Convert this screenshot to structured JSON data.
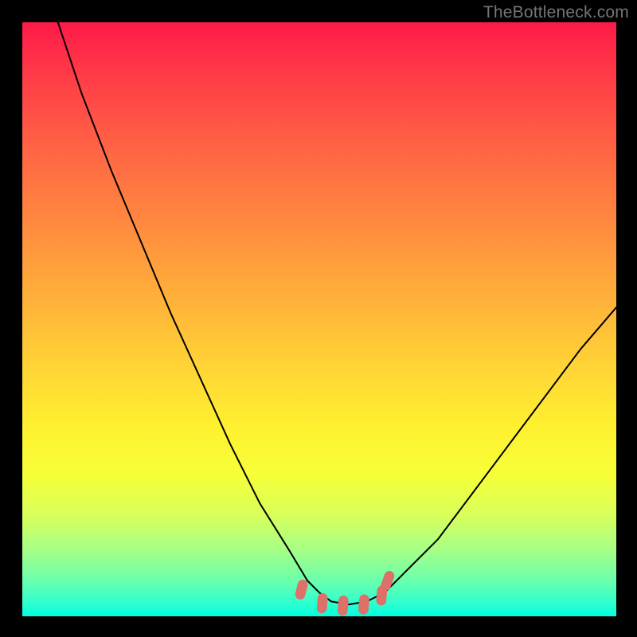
{
  "watermark": "TheBottleneck.com",
  "colors": {
    "frame_bg": "#000000",
    "curve": "#000000",
    "marker": "#dd7068",
    "watermark_text": "#757575",
    "gradient_top": "#ff1a49",
    "gradient_bottom": "#00ffe0"
  },
  "chart_data": {
    "type": "line",
    "title": "",
    "xlabel": "",
    "ylabel": "",
    "xlim": [
      0,
      100
    ],
    "ylim": [
      0,
      100
    ],
    "note": "Axes are unlabeled in the image; x and y are in percent of plot width/height. y=0 at bottom (green), y=100 at top (red). Curve is a V-shape with minimum near x≈55; right branch exits around y≈50 at right edge.",
    "series": [
      {
        "name": "bottleneck-curve",
        "x": [
          6,
          10,
          15,
          20,
          25,
          30,
          35,
          40,
          45,
          48,
          50,
          52,
          55,
          58,
          61,
          64,
          70,
          76,
          82,
          88,
          94,
          100
        ],
        "y": [
          100,
          88,
          75,
          63,
          51,
          40,
          29,
          19,
          11,
          6,
          4,
          2.5,
          2,
          2.5,
          4,
          7,
          13,
          21,
          29,
          37,
          45,
          52
        ]
      }
    ],
    "markers": {
      "name": "trough-markers",
      "x": [
        47,
        50.5,
        54,
        57.5,
        60.5,
        61.5
      ],
      "y": [
        4.5,
        2.2,
        1.8,
        2.0,
        3.5,
        6.0
      ]
    }
  }
}
